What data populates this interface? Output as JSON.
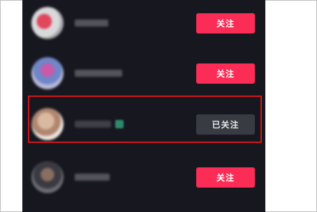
{
  "users": [
    {
      "follow_label": "关注",
      "state": "not_followed"
    },
    {
      "follow_label": "关注",
      "state": "not_followed"
    },
    {
      "follow_label": "已关注",
      "state": "followed"
    },
    {
      "follow_label": "关注",
      "state": "not_followed"
    }
  ],
  "colors": {
    "follow_button": "#fb2c55",
    "followed_button": "#393b44",
    "panel_background": "#17181f",
    "highlight_border": "#d2161a"
  }
}
